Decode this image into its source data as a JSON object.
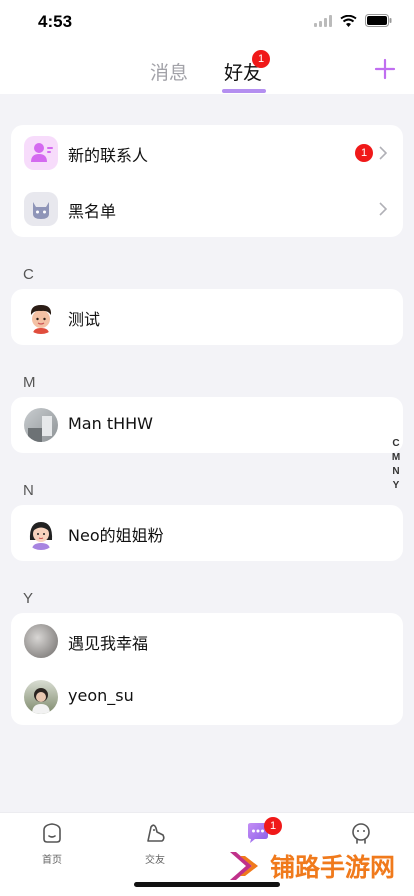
{
  "status_bar": {
    "time": "4:53"
  },
  "header": {
    "tabs": [
      {
        "label": "消息"
      },
      {
        "label": "好友",
        "badge": "1"
      }
    ]
  },
  "special_rows": [
    {
      "label": "新的联系人",
      "badge": "1",
      "icon": "new-contact-icon"
    },
    {
      "label": "黑名单",
      "icon": "blacklist-cat-icon"
    }
  ],
  "sections": [
    {
      "letter": "C",
      "contacts": [
        {
          "name": "测试"
        }
      ]
    },
    {
      "letter": "M",
      "contacts": [
        {
          "name": "Man tHHW"
        }
      ]
    },
    {
      "letter": "N",
      "contacts": [
        {
          "name": "Neo的姐姐粉"
        }
      ]
    },
    {
      "letter": "Y",
      "contacts": [
        {
          "name": "遇见我幸福"
        },
        {
          "name": "yeon_su"
        }
      ]
    }
  ],
  "index_bar": [
    "C",
    "M",
    "N",
    "Y"
  ],
  "bottom_nav": [
    {
      "label": "首页",
      "icon": "home-icon"
    },
    {
      "label": "交友",
      "icon": "dating-icon"
    },
    {
      "label": "",
      "icon": "chat-bubble-icon",
      "badge": "1"
    },
    {
      "label": "",
      "icon": "profile-icon"
    }
  ],
  "watermark": {
    "text": "铺路手游网"
  },
  "colors": {
    "accent": "#b48ff0",
    "badge": "#f01919",
    "background": "#f3f3f7"
  }
}
